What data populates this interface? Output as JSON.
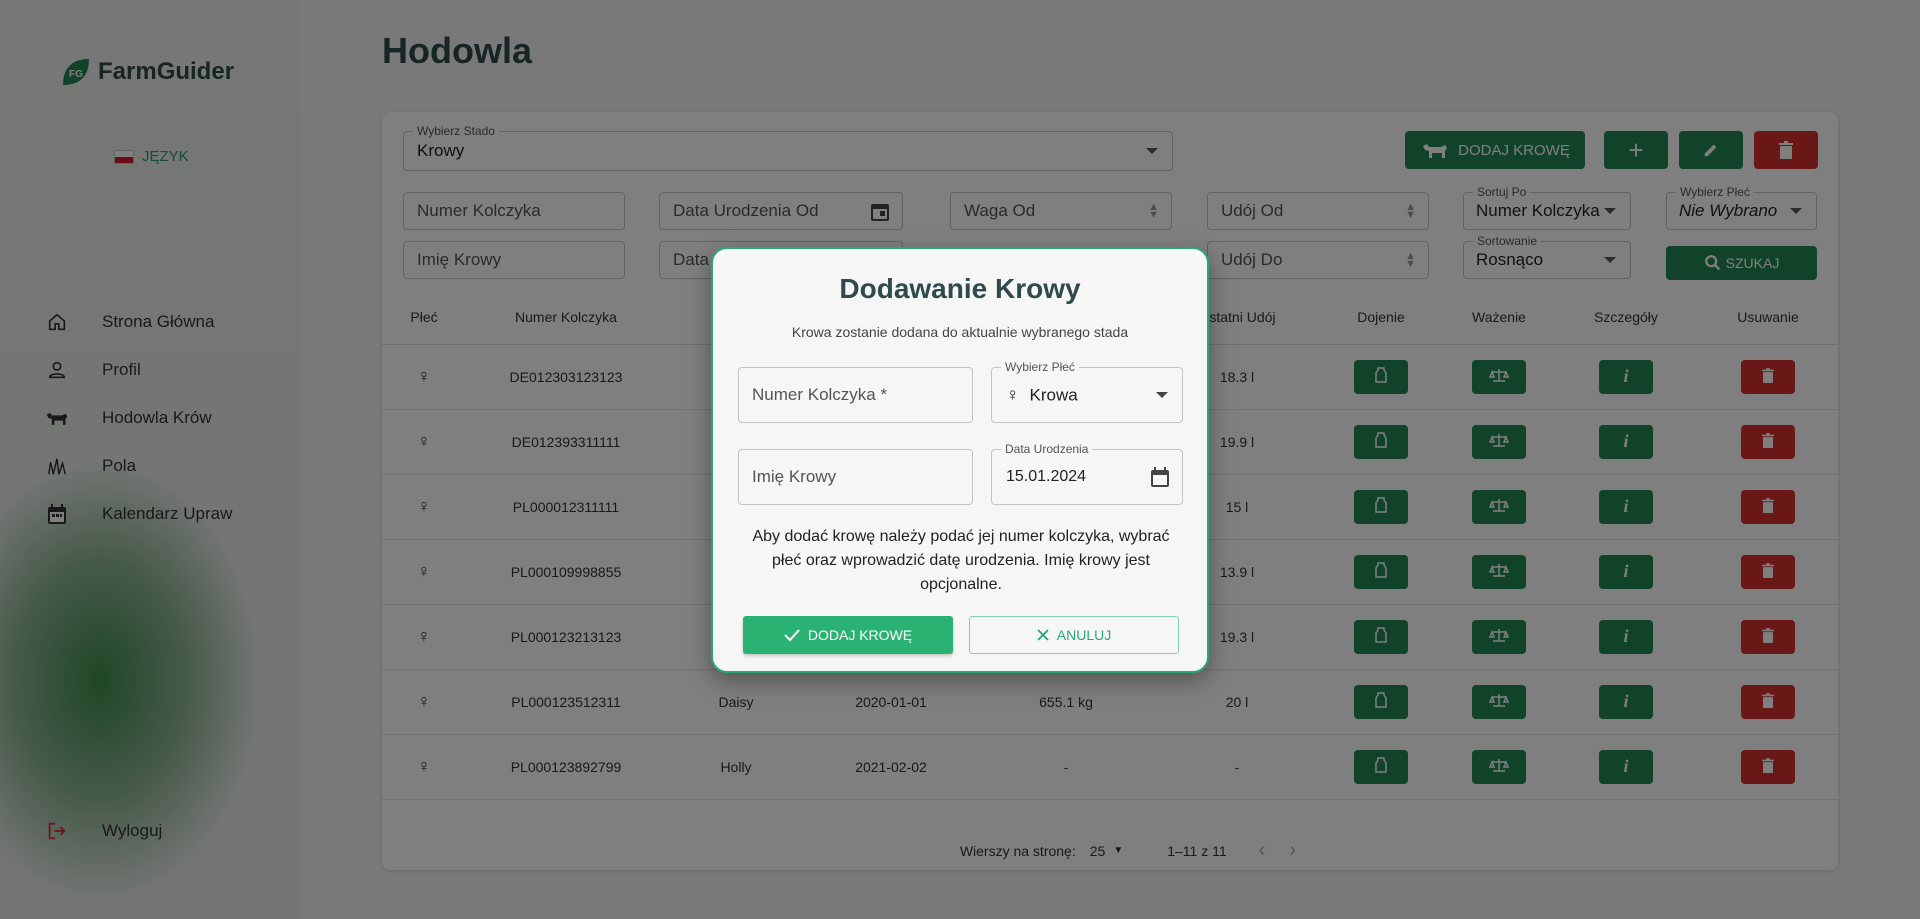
{
  "app": {
    "name": "FarmGuider",
    "language_label": "JĘZYK"
  },
  "nav": {
    "items": [
      {
        "label": "Strona Główna",
        "icon": "home-icon"
      },
      {
        "label": "Profil",
        "icon": "person-icon"
      },
      {
        "label": "Hodowla Krów",
        "icon": "cow-icon"
      },
      {
        "label": "Pola",
        "icon": "grass-icon"
      },
      {
        "label": "Kalendarz Upraw",
        "icon": "calendar-icon"
      }
    ],
    "logout": "Wyloguj"
  },
  "page": {
    "title": "Hodowla"
  },
  "toolbar": {
    "herd_label": "Wybierz Stado",
    "herd_value": "Krowy",
    "add_cow": "DODAJ KROWĘ"
  },
  "filters": {
    "tag_number": "Numer Kolczyka",
    "birth_from": "Data Urodzenia Od",
    "weight_from": "Waga Od",
    "milk_from": "Udój Od",
    "sort_by_label": "Sortuj Po",
    "sort_by_value": "Numer Kolczyka",
    "sex_label": "Wybierz Płeć",
    "sex_value": "Nie Wybrano",
    "cow_name": "Imię Krowy",
    "birth_to": "Data",
    "milk_to": "Udój Do",
    "order_label": "Sortowanie",
    "order_value": "Rosnąco",
    "search": "SZUKAJ"
  },
  "table": {
    "headers": {
      "sex": "Płeć",
      "tag": "Numer Kolczyka",
      "last_milk": "Ostatni Udój",
      "milking": "Dojenie",
      "weighing": "Ważenie",
      "details": "Szczegóły",
      "delete": "Usuwanie"
    },
    "rows": [
      {
        "tag": "DE012303123123",
        "name": "",
        "birth": "",
        "weight": "",
        "milk": "18.3 l"
      },
      {
        "tag": "DE012393311111",
        "name": "",
        "birth": "",
        "weight": "",
        "milk": "19.9 l"
      },
      {
        "tag": "PL000012311111",
        "name": "",
        "birth": "",
        "weight": "",
        "milk": "15 l"
      },
      {
        "tag": "PL000109998855",
        "name": "",
        "birth": "",
        "weight": "",
        "milk": "13.9 l"
      },
      {
        "tag": "PL000123213123",
        "name": "",
        "birth": "",
        "weight": "",
        "milk": "19.3 l"
      },
      {
        "tag": "PL000123512311",
        "name": "Daisy",
        "birth": "2020-01-01",
        "weight": "655.1 kg",
        "milk": "20 l"
      },
      {
        "tag": "PL000123892799",
        "name": "Holly",
        "birth": "2021-02-02",
        "weight": "-",
        "milk": "-"
      }
    ]
  },
  "pagination": {
    "rows_label": "Wierszy na stronę:",
    "rows_value": "25",
    "range": "1–11 z 11"
  },
  "modal": {
    "title": "Dodawanie Krowy",
    "subtitle": "Krowa zostanie dodana do aktualnie wybranego stada",
    "tag_placeholder": "Numer Kolczyka *",
    "sex_label": "Wybierz Płeć",
    "sex_value": "Krowa",
    "name_placeholder": "Imię Krowy",
    "birth_label": "Data Urodzenia",
    "birth_value": "15.01.2024",
    "info": "Aby dodać krowę należy podać jej numer kolczyka, wybrać płeć oraz wprowadzić datę urodzenia. Imię krowy jest opcjonalne.",
    "add": "DODAJ KROWĘ",
    "cancel": "ANULUJ"
  },
  "colors": {
    "primary": "#218755",
    "accent": "#2ab273",
    "danger": "#d32f2f",
    "title": "#2f4a4b"
  }
}
